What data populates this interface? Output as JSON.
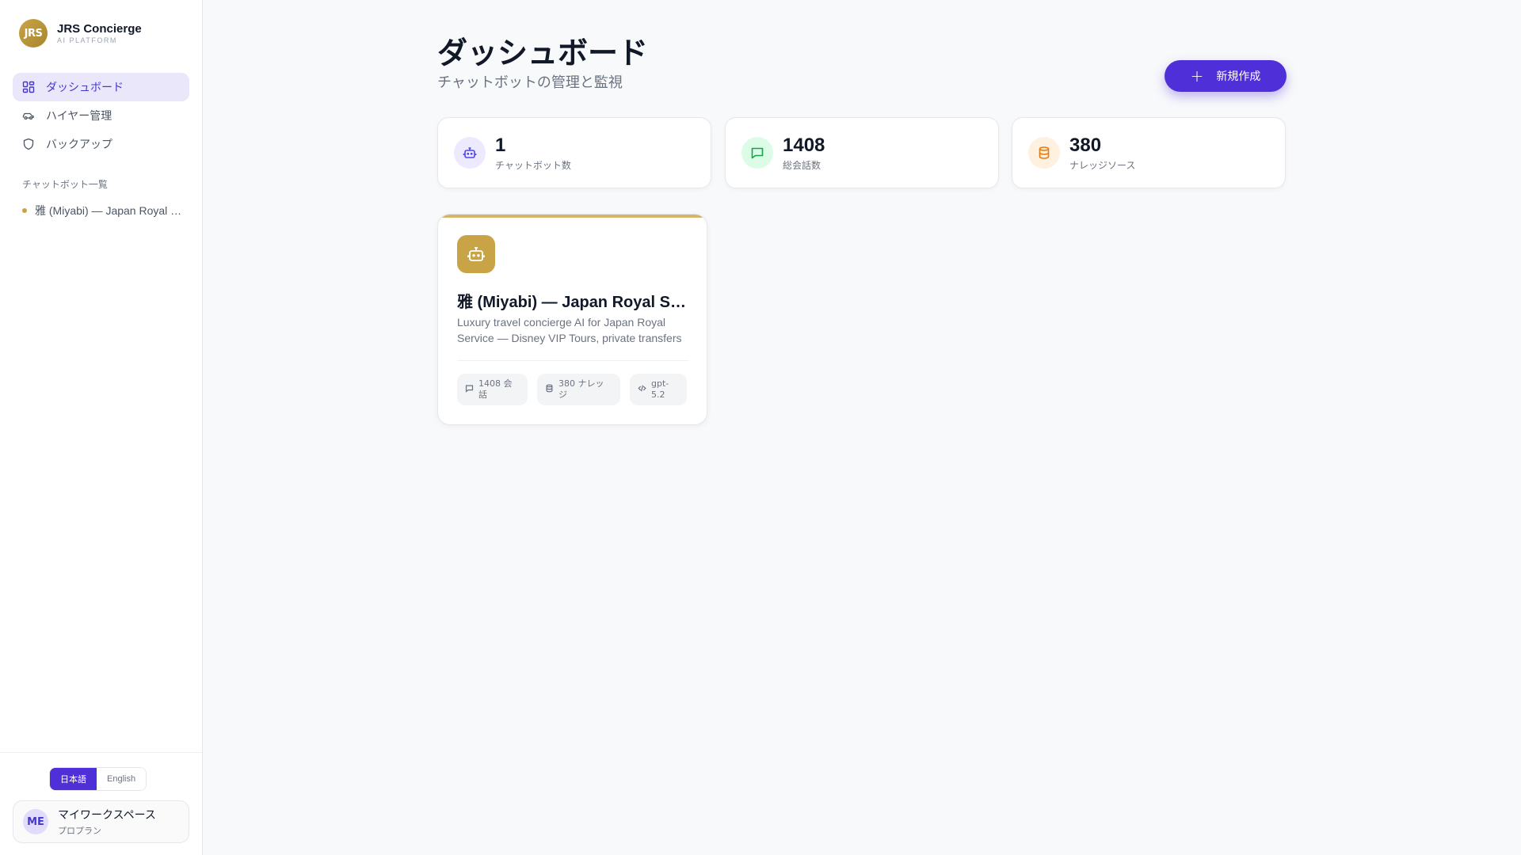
{
  "brand": {
    "logo_text": "JRS",
    "name": "JRS Concierge",
    "subtitle": "AI PLATFORM"
  },
  "nav": [
    {
      "label": "ダッシュボード",
      "icon": "dashboard-grid-icon",
      "active": true
    },
    {
      "label": "ハイヤー管理",
      "icon": "car-icon",
      "active": false
    },
    {
      "label": "バックアップ",
      "icon": "shield-icon",
      "active": false
    }
  ],
  "chatbot_list": {
    "heading": "チャットボット一覧",
    "items": [
      {
        "label": "雅 (Miyabi) — Japan Royal Service",
        "status_color": "#c9a446"
      }
    ]
  },
  "language": {
    "options": [
      "日本語",
      "English"
    ],
    "selected": "日本語"
  },
  "workspace": {
    "avatar": "ME",
    "name": "マイワークスペース",
    "plan": "プロプラン"
  },
  "header": {
    "title": "ダッシュボード",
    "subtitle": "チャットボットの管理と監視",
    "new_button": "新規作成"
  },
  "stats": [
    {
      "value": "1",
      "label": "チャットボット数",
      "icon": "robot-icon",
      "color": "#4f46e5",
      "bg": "#ede9fe"
    },
    {
      "value": "1408",
      "label": "総会話数",
      "icon": "message-icon",
      "color": "#16a34a",
      "bg": "#dcfce7"
    },
    {
      "value": "380",
      "label": "ナレッジソース",
      "icon": "database-icon",
      "color": "#ea7a0c",
      "bg": "#fff1e0"
    }
  ],
  "bot_card": {
    "icon": "robot-icon",
    "accent": "#c9a446",
    "title": "雅 (Miyabi) — Japan Royal Service",
    "description": "Luxury travel concierge AI for Japan Royal Service — Disney VIP Tours, private transfers and more.",
    "tags": {
      "conversations": "1408 会話",
      "knowledge": "380 ナレッジ",
      "model": "gpt-5.2"
    }
  },
  "colors": {
    "primary": "#4f2fd8",
    "gold": "#c9a446",
    "background": "#f8f9fb"
  }
}
